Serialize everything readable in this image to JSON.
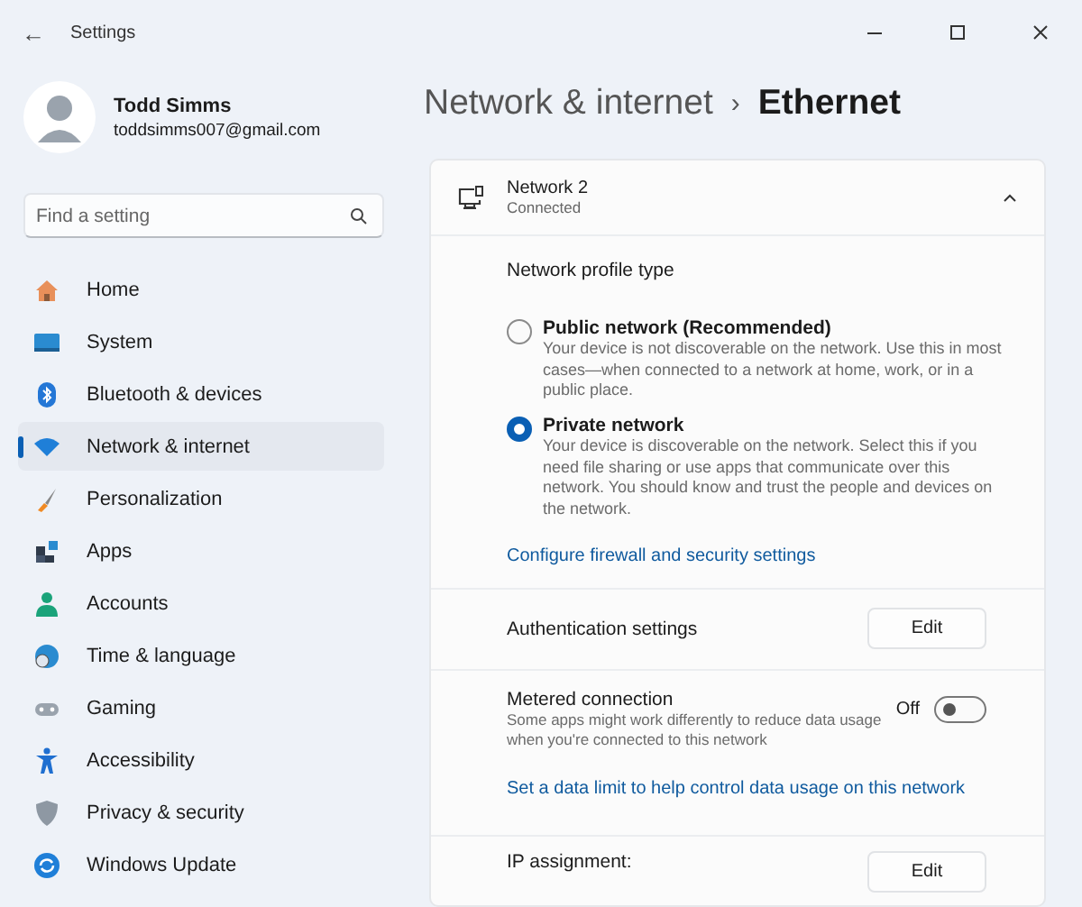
{
  "window": {
    "title": "Settings",
    "back": "←"
  },
  "user": {
    "name": "Todd Simms",
    "email": "toddsimms007@gmail.com"
  },
  "search": {
    "placeholder": "Find a setting"
  },
  "sidebar": {
    "items": [
      {
        "label": "Home",
        "selected": false
      },
      {
        "label": "System",
        "selected": false
      },
      {
        "label": "Bluetooth & devices",
        "selected": false
      },
      {
        "label": "Network & internet",
        "selected": true
      },
      {
        "label": "Personalization",
        "selected": false
      },
      {
        "label": "Apps",
        "selected": false
      },
      {
        "label": "Accounts",
        "selected": false
      },
      {
        "label": "Time & language",
        "selected": false
      },
      {
        "label": "Gaming",
        "selected": false
      },
      {
        "label": "Accessibility",
        "selected": false
      },
      {
        "label": "Privacy & security",
        "selected": false
      },
      {
        "label": "Windows Update",
        "selected": false
      }
    ]
  },
  "breadcrumb": {
    "parent": "Network & internet",
    "separator": "›",
    "current": "Ethernet"
  },
  "network": {
    "name": "Network 2",
    "status": "Connected",
    "expanded": true
  },
  "profile": {
    "heading": "Network profile type",
    "options": [
      {
        "title": "Public network (Recommended)",
        "description": "Your device is not discoverable on the network. Use this in most cases—when connected to a network at home, work, or in a public place.",
        "selected": false
      },
      {
        "title": "Private network",
        "description": "Your device is discoverable on the network. Select this if you need file sharing or use apps that communicate over this network. You should know and trust the people and devices on the network.",
        "selected": true
      }
    ],
    "link": "Configure firewall and security settings"
  },
  "authentication": {
    "label": "Authentication settings",
    "button": "Edit"
  },
  "metered": {
    "label": "Metered connection",
    "description": "Some apps might work differently to reduce data usage when you're connected to this network",
    "state_label": "Off",
    "on": false,
    "link": "Set a data limit to help control data usage on this network"
  },
  "ip_assignment": {
    "label": "IP assignment:",
    "button": "Edit"
  }
}
